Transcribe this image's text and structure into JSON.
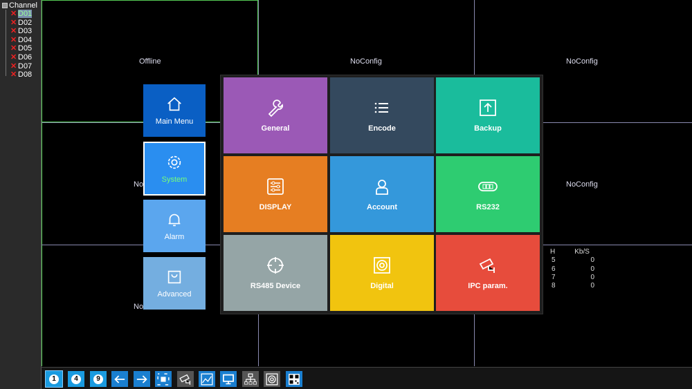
{
  "sidebar": {
    "title": "Channel",
    "channels": [
      "D01",
      "D02",
      "D03",
      "D04",
      "D05",
      "D06",
      "D07",
      "D08"
    ],
    "selected": "D01"
  },
  "video": {
    "labels": [
      "Offline",
      "NoConfig",
      "NoConfig",
      "No",
      "NoConfig",
      "No"
    ]
  },
  "stats": {
    "headers": [
      "H",
      "Kb/S"
    ],
    "rows": [
      [
        "5",
        "0"
      ],
      [
        "6",
        "0"
      ],
      [
        "7",
        "0"
      ],
      [
        "8",
        "0"
      ]
    ]
  },
  "side_menu": [
    {
      "label": "Main Menu",
      "icon": "home-icon",
      "color": "#0a5fc4"
    },
    {
      "label": "System",
      "icon": "gear-icon",
      "color": "#2a8ef0",
      "active": true
    },
    {
      "label": "Alarm",
      "icon": "bell-icon",
      "color": "#5ba6ee"
    },
    {
      "label": "Advanced",
      "icon": "bag-icon",
      "color": "#74aee0"
    }
  ],
  "tiles": [
    {
      "label": "General",
      "icon": "wrench-icon",
      "color": "#9b59b6"
    },
    {
      "label": "Encode",
      "icon": "list-icon",
      "color": "#34495e"
    },
    {
      "label": "Backup",
      "icon": "upload-icon",
      "color": "#1abc9c"
    },
    {
      "label": "DISPLAY",
      "icon": "sliders-icon",
      "color": "#e67e22"
    },
    {
      "label": "Account",
      "icon": "user-icon",
      "color": "#3498db"
    },
    {
      "label": "RS232",
      "icon": "port-icon",
      "color": "#2ecc71"
    },
    {
      "label": "RS485 Device",
      "icon": "crosshair-icon",
      "color": "#95a5a6"
    },
    {
      "label": "Digital",
      "icon": "disk-icon",
      "color": "#f1c40f"
    },
    {
      "label": "IPC param.",
      "icon": "camera-icon",
      "color": "#e74c3c"
    }
  ],
  "toolbar": [
    {
      "name": "view-1-button",
      "text": "1"
    },
    {
      "name": "view-4-button",
      "text": "4"
    },
    {
      "name": "view-9-button",
      "text": "9"
    },
    {
      "name": "prev-button",
      "icon": "arrow-left-icon"
    },
    {
      "name": "next-button",
      "icon": "arrow-right-icon"
    },
    {
      "name": "fullscreen-button",
      "icon": "fullscreen-icon"
    },
    {
      "name": "camera-button",
      "icon": "camera-icon"
    },
    {
      "name": "chart-button",
      "icon": "chart-icon"
    },
    {
      "name": "monitor-button",
      "icon": "monitor-icon"
    },
    {
      "name": "network-button",
      "icon": "network-icon"
    },
    {
      "name": "disk-button",
      "icon": "disk-icon"
    },
    {
      "name": "qr-button",
      "icon": "qr-icon"
    }
  ]
}
